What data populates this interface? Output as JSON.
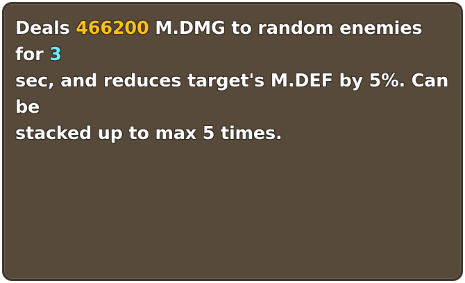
{
  "skill_tooltip": {
    "text_before_damage": "Deals ",
    "damage_value": "466200",
    "text_before_duration": " M.DMG to random enemies for ",
    "duration_value": "3",
    "line2": "sec, and reduces target's M.DEF by 5%. Can be",
    "line3": "stacked up to max 5 times.",
    "colors": {
      "panel_background": "#584a3a",
      "panel_border": "#3a3129",
      "text": "#ffffff",
      "damage_highlight": "#ffc21a",
      "duration_highlight": "#6ff0ff"
    }
  }
}
